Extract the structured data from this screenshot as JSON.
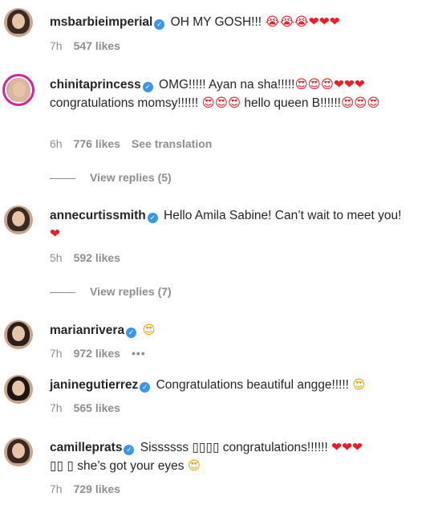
{
  "comments": [
    {
      "username": "msbarbieimperial",
      "text": "OH MY GOSH!!!",
      "emoji": "😭😭😭❤❤❤",
      "time": "7h",
      "likes": "547 likes"
    },
    {
      "username": "chinitaprincess",
      "text": "OMG!!!!! Ayan na sha!!!!!",
      "emoji1": "😍😍😍❤❤❤",
      "text2": "congratulations momsy!!!!!!",
      "emoji2": "😍😍😍",
      "text3": "hello queen B!!!!!!",
      "emoji3": "😍😍😍",
      "time": "6h",
      "likes": "776 likes",
      "translate": "See translation",
      "replies": "View replies (5)"
    },
    {
      "username": "annecurtissmith",
      "text": "Hello Amila Sabine! Can’t wait to meet you!",
      "emoji": "❤",
      "time": "5h",
      "likes": "592 likes",
      "replies": "View replies (7)"
    },
    {
      "username": "marianrivera",
      "emoji": "😍",
      "time": "7h",
      "likes": "972 likes",
      "more": "•••"
    },
    {
      "username": "janinegutierrez",
      "text": "Congratulations beautiful angge!!!!!",
      "emoji": "😍",
      "time": "7h",
      "likes": "565 likes"
    },
    {
      "username": "camilleprats",
      "text": "Sissssss ▯▯▯▯ congratulations!!!!!!",
      "emoji": "❤❤❤",
      "text2": "▯▯ ▯ she’s got your eyes",
      "emoji2": "😍",
      "time": "7h",
      "likes": "729 likes"
    }
  ],
  "colors": {
    "verified": "#3897f0",
    "muted": "#8e8e8e",
    "heart": "#ed1c24",
    "story_ring": "#d6249f"
  }
}
